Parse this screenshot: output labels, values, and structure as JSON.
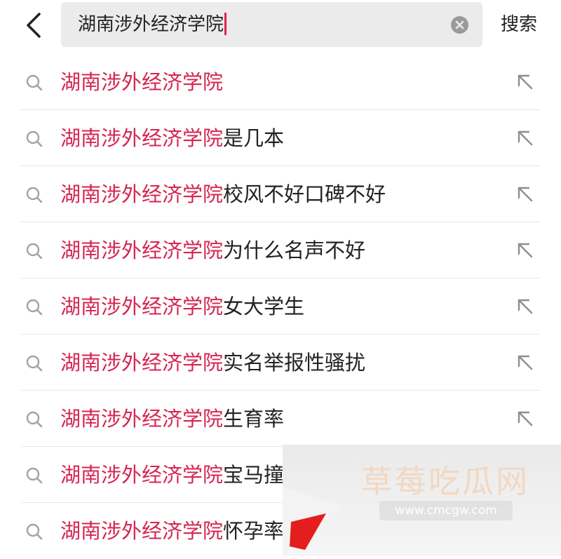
{
  "search": {
    "value": "湖南涉外经济学院",
    "submit_label": "搜索"
  },
  "suggestions": [
    {
      "highlight": "湖南涉外经济学院",
      "rest": ""
    },
    {
      "highlight": "湖南涉外经济学院",
      "rest": "是几本"
    },
    {
      "highlight": "湖南涉外经济学院",
      "rest": "校风不好口碑不好"
    },
    {
      "highlight": "湖南涉外经济学院",
      "rest": "为什么名声不好"
    },
    {
      "highlight": "湖南涉外经济学院",
      "rest": "女大学生"
    },
    {
      "highlight": "湖南涉外经济学院",
      "rest": "实名举报性骚扰"
    },
    {
      "highlight": "湖南涉外经济学院",
      "rest": "生育率"
    },
    {
      "highlight": "湖南涉外经济学院",
      "rest": "宝马撞"
    },
    {
      "highlight": "湖南涉外经济学院",
      "rest": "怀孕率"
    }
  ],
  "watermark": {
    "title": "草莓吃瓜网",
    "url": "www.cmcgw.com"
  },
  "icons": {
    "back": "chevron-left-icon",
    "clear": "clear-circle-x-icon",
    "suggestion": "search-icon",
    "fill": "arrow-up-left-icon"
  },
  "colors": {
    "highlight": "#d62552",
    "caret": "#e3214f",
    "search_bg": "#ebebeb"
  }
}
